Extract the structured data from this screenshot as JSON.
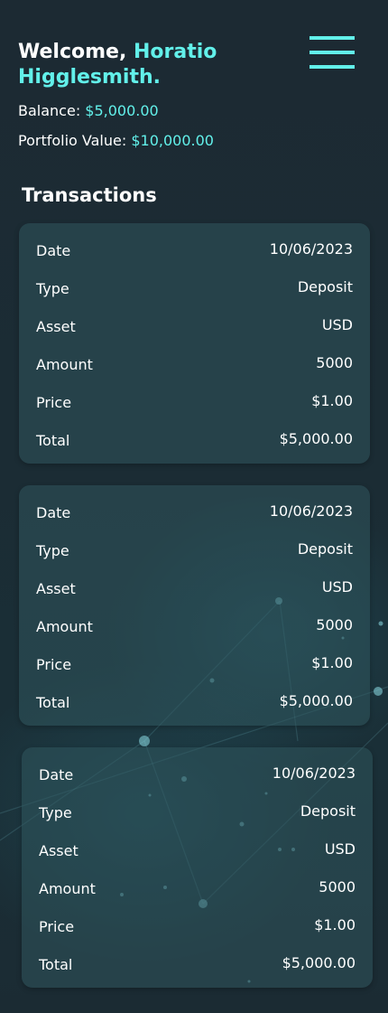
{
  "header": {
    "welcome_prefix": "Welcome,",
    "user_name": "Horatio Higglesmith.",
    "balance_label": "Balance:",
    "balance_value": "$5,000.00",
    "portfolio_label": "Portfolio Value:",
    "portfolio_value": "$10,000.00"
  },
  "menu": {
    "icon": "hamburger-menu-icon"
  },
  "transactions": {
    "title": "Transactions",
    "labels": {
      "date": "Date",
      "type": "Type",
      "asset": "Asset",
      "amount": "Amount",
      "price": "Price",
      "total": "Total"
    },
    "items": [
      {
        "date": "10/06/2023",
        "type": "Deposit",
        "asset": "USD",
        "amount": "5000",
        "price": "$1.00",
        "total": "$5,000.00"
      },
      {
        "date": "10/06/2023",
        "type": "Deposit",
        "asset": "USD",
        "amount": "5000",
        "price": "$1.00",
        "total": "$5,000.00"
      },
      {
        "date": "10/06/2023",
        "type": "Deposit",
        "asset": "USD",
        "amount": "5000",
        "price": "$1.00",
        "total": "$5,000.00"
      }
    ]
  },
  "colors": {
    "accent": "#62f0ea",
    "background": "#1b2a33",
    "card": "#30565d"
  }
}
